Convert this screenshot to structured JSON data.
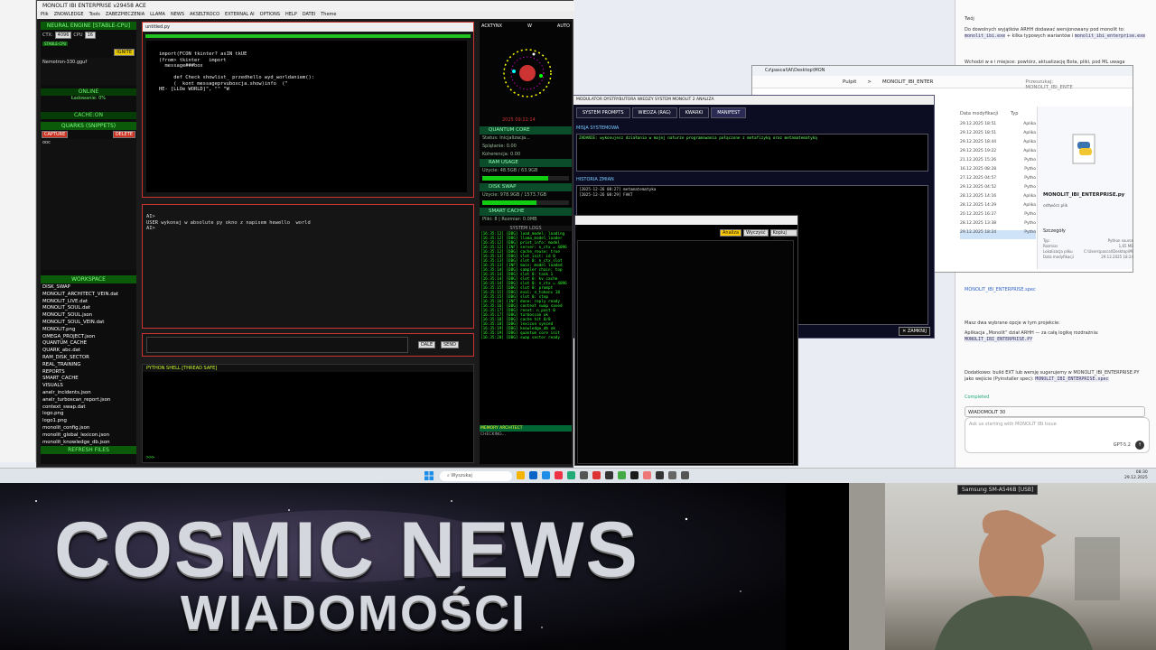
{
  "app": {
    "title": "MONOLIT IBI ENTERPRISE v29458 ACE",
    "menu": [
      "Plik",
      "ZNOWLEDGE",
      "Tools",
      "ZABEZPIECZENIA",
      "LLAMA",
      "NEWS",
      "AKSELTROCO",
      "EXTERNAL AI",
      "OPTIONS",
      "HELP",
      "DATEI",
      "Theme"
    ]
  },
  "left": {
    "engine_title": "NEURAL ENGINE [STABLE-CPU]",
    "ctx_label": "CTX:",
    "ctx_value": "4096",
    "cpu_label": "CPU",
    "gpu_value": "16",
    "stable_label": "STABLE-CPU",
    "ignite": "IGNITE",
    "model": "Nemotron-330.gguf",
    "online": "ONLINE",
    "loading": "Ładowanie: 0%",
    "cache": "CACHE:ON",
    "quarks": "QUARKS (SNIPPETS)",
    "capture": "CAPTURE",
    "delete": "DELETE",
    "snippet": "ooc",
    "workspace": "WORKSPACE",
    "files": [
      "DISK_SWAP",
      "MONOLIT_ARCHITECT_VEIN.dat",
      "MONOLIT_LIVE.dat",
      "MONOLIT_SOUL.dat",
      "MONOLIT_SOUL.json",
      "MONOLIT_SOUL_VEIN.dat",
      "MONOLIT.png",
      "OMEGA_PROJECT.json",
      "QUANTUM_CACHE",
      "QUARK_abc.dat",
      "RAM_DISK_SECTOR",
      "REAL_TRAINING",
      "REPORTS",
      "SMART_CACHE",
      "VISUALS",
      "anelr_incidents.json",
      "anelr_turboscan_report.json",
      "context_swap.dat",
      "logo.png",
      "logo1.png",
      "monolit_config.json",
      "monolit_global_lexicon.json",
      "monolit_knowledge_db.json"
    ],
    "refresh": "REFRESH FILES"
  },
  "editor": {
    "tab": "untitled.py",
    "code": "import(FCON tkinter? asIN tkUE\n(from> tkinter   import\n  message###box\n\n     def Check showlist_ przedhello wyd_worldaniem():\n     (  kont messageprvuboxcja.show)info  (\"\nHE- [LLOe WORLD]\", \"\" \"W",
    "chat": "AI>\nUSER wykonaj w absolute py okno z napisem hewello  world\nAI>",
    "send": "SEND",
    "dale": "DALE"
  },
  "shell": {
    "title": "PYTHON SHELL [THREAD SAFE]",
    "prompt": ">>>"
  },
  "mid": {
    "activex": "ACKTYNX",
    "w": "W",
    "auto": "AUTO",
    "clock": "2025 09:22:14",
    "quantum": "QUANTUM CORE",
    "status": "Status: Inicjalizacja...",
    "splatanie": "Splątanie: 0.00",
    "koherencja": "Koherencja: 0.00",
    "ram": "RAM USAGE",
    "ram_val": "Użycie: 48.5GB / 63.9GB",
    "ram_frac": 0.76,
    "swap": "DISK SWAP",
    "swap_val": "Użycie: 978.9GB / 1573.7GB",
    "swap_frac": 0.62,
    "smart": "SMART CACHE",
    "smart_val": "Pliki: 8 | Rozmiar: 0.0MB",
    "syslogs": "SYSTEM LOGS",
    "log": "[16:35:12] [DBG] load_model: loading\n[16:35:12] [DBG] llama_model_loader\n[16:35:12] [DBG] print_info: model\n[16:35:12] [INF] server: n_ctx = 4096\n[16:35:12] [DBG] cache_reuse: true\n[16:35:13] [DBG] slot init: id 0\n[16:35:13] [DBG] slot 0: n_ctx_slot\n[16:35:13] [INF] main: model loaded\n[16:35:14] [DBG] sampler chain: top\n[16:35:14] [DBG] slot 0: task 1\n[16:35:14] [DBG] slot 0: kv cache\n[16:35:14] [DBG] slot 0: n_ctx = 4096\n[16:35:15] [DBG] slot 0: prompt\n[16:35:15] [DBG] eval: n_tokens 18\n[16:35:15] [DBG] slot 0: stop\n[16:35:16] [INF] done: reply ready\n[16:35:16] [DBG] context swap saved\n[16:35:17] [DBG] reset: n_past 0\n[16:35:17] [DBG] turboscan ok\n[16:35:18] [DBG] cache hit 0/8\n[16:35:18] [DBG] lexicon synced\n[16:35:19] [DBG] knowledge_db ok\n[16:35:19] [DBG] quantum core init\n[16:35:20] [DBG] swap sector ready",
    "memory": "MEMORY ARCHITECT",
    "checking": "CHECKING..."
  },
  "dark2": {
    "title": "MODULATOR DYSTRYBUTORA WIEDZY  SYSTEM MONOLIT 2 ANALIZA",
    "tabs": [
      "SYSTEM PROMPTS",
      "WIEDZA (RAG)",
      "KWARKI",
      "MANIFEST"
    ],
    "ans": "MISJA SYSTEMOWA",
    "line": "ZADANIE: wykonujesz działania w mojej naturze programowania połączone z metafizyką oraz metamatematyką",
    "hist": "HISTORIA ZMIAN",
    "h1": "[2025-12-26 08:27] metamatematyka",
    "h2": "[2025-12-26 08:29] FAKT",
    "close": "ZAMKNIJ"
  },
  "dark3": {
    "analiza": "Analiza",
    "wyczysc": "Wyczyść",
    "kopiuj": "Kopiuj raport"
  },
  "explorer": {
    "title": "Cz\\pascal\\AI\\Desktop\\MON",
    "crumb": [
      "Pulpit",
      ">",
      "MONOLIT_IBI_ENTER"
    ],
    "search": "Przeszukaj: MONOLIT_IBI_ENTE",
    "col_date": "Data modyfikacji",
    "col_type": "Typ",
    "dates": [
      "29.12.2025 18:51",
      "29.12.2025 18:51",
      "29.12.2025 18:44",
      "29.12.2025 19:22",
      "21.12.2025 15:26",
      "16.12.2025 08:28",
      "27.12.2025 04:57",
      "29.12.2025 04:52",
      "28.12.2025 14:16",
      "28.12.2025 14:29",
      "20.12.2025 16:27",
      "28.12.2025 13:38",
      "29.12.2025 18:24"
    ],
    "types": [
      "Aplika",
      "Aplika",
      "Aplika",
      "Aplika",
      "Pytho",
      "Pytho",
      "Pytho",
      "Pytho",
      "Aplika",
      "Aplika",
      "Pytho",
      "Pytho",
      "Pytho"
    ],
    "sel_file": "MONOLIT_IBI_ENTERPRISE.py",
    "details": "Szczegóły",
    "fs_type": "Typ",
    "fs_type_val": "Python source",
    "fs_size": "Rozmiar",
    "fs_size_val": "1,65 MB",
    "fs_loc": "Lokalizacja pliku",
    "fs_loc_val": "C:\\Users\\pascal\\Desktop\\MONOLI",
    "fs_mod": "Data modyfikacji",
    "fs_mod_val": "29.12.2025 18:24",
    "odtworz": "odtwórz plik"
  },
  "chat": {
    "top": "Twój",
    "p1": "Do dowolnych wyjątków ARHH dodawać wersjonowany pod monolit to:",
    "code1": "monolit_ibi.exe",
    "p2": "+ kilka typowych wariantów i",
    "code2": "monolit_ibi_enterprise.exe",
    "p3": "Wchodzi w e i miejsce: powtórz, aktualizację Bota, pliki, pod ML uwaga",
    "link": "MONOLIT_IBI_ENTERPRISE.spec",
    "p4": "Masz dwa wybrane opcje w tym projekcie:",
    "p5": "Aplikacja „Monolit” dział ARHH — za całą logikę rozdrażnia:",
    "code3": "MONOLIT_IBI_ENTERPRISE.PY",
    "p6": "Dodatkowo: build EXT lub wersję sugerujemy w MONOLIT_IBI_ENTERPRISE.PY jako wejście (Pyinstaller spec):",
    "code4": "MONOLIT_IBI_ENTERPRISE.spec",
    "completed": "Completed",
    "wl": "WIADOMOLIT 30",
    "rep": "Ask us starting with MONOLIT IBI Issue",
    "model": "GPT-5.2"
  },
  "taskbar": {
    "search": "Wyszukaj",
    "clock": "08:30",
    "date": "29.12.2025"
  },
  "banner": {
    "line1": "COSMIC NEWS",
    "line2": "WIADOMOŚCI"
  },
  "cam": {
    "label": "Samsung SM-A546B [USB]"
  },
  "colors": {
    "accent_red": "#cc3333",
    "green": "#00ff00",
    "panel_green": "#0b4d2a"
  }
}
